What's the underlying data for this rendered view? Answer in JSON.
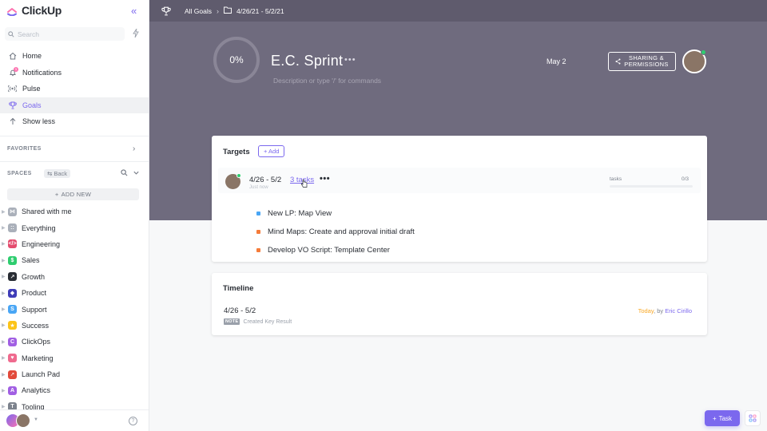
{
  "app": {
    "name": "ClickUp"
  },
  "sidebar": {
    "search_placeholder": "Search",
    "nav": [
      {
        "label": "Home",
        "icon": "home-icon"
      },
      {
        "label": "Notifications",
        "icon": "bell-icon",
        "badge": "1"
      },
      {
        "label": "Pulse",
        "icon": "pulse-icon"
      },
      {
        "label": "Goals",
        "icon": "trophy-icon",
        "active": true
      },
      {
        "label": "Show less",
        "icon": "arrow-up-icon"
      }
    ],
    "favorites_title": "FAVORITES",
    "spaces_title": "SPACES",
    "back_label": "Back",
    "add_new_label": "ADD NEW",
    "spaces": [
      {
        "label": "Shared with me",
        "color": "#aab0ba",
        "glyph": "⋈"
      },
      {
        "label": "Everything",
        "color": "#aab0ba",
        "glyph": "::"
      },
      {
        "label": "Engineering",
        "color": "#e44c6e",
        "glyph": "</>"
      },
      {
        "label": "Sales",
        "color": "#2ecd6f",
        "glyph": "$"
      },
      {
        "label": "Growth",
        "color": "#292d34",
        "glyph": "↗"
      },
      {
        "label": "Product",
        "color": "#3f3db8",
        "glyph": "◆"
      },
      {
        "label": "Support",
        "color": "#49a6f5",
        "glyph": "S"
      },
      {
        "label": "Success",
        "color": "#fcc419",
        "glyph": "★"
      },
      {
        "label": "ClickOps",
        "color": "#a15fe3",
        "glyph": "C"
      },
      {
        "label": "Marketing",
        "color": "#ef6a8e",
        "glyph": "♥"
      },
      {
        "label": "Launch Pad",
        "color": "#e24a3b",
        "glyph": "➚"
      },
      {
        "label": "Analytics",
        "color": "#a15fe3",
        "glyph": "A"
      },
      {
        "label": "Tooling",
        "color": "#7c828d",
        "glyph": "T"
      }
    ]
  },
  "topbar": {
    "all_goals": "All Goals",
    "folder": "4/26/21 - 5/2/21"
  },
  "goal": {
    "progress_text": "0%",
    "progress_fraction": 0,
    "title": "E.C. Sprint",
    "description_placeholder": "Description or type '/' for commands",
    "due_date": "May 2",
    "share_label_1": "SHARING &",
    "share_label_2": "PERMISSIONS"
  },
  "targets": {
    "title": "Targets",
    "add_label": "+ Add",
    "row": {
      "range": "4/26 - 5/2",
      "tasks_link": "3 tasks",
      "sub": "Just now",
      "progress_label": "tasks",
      "progress_count": "0/3",
      "progress_fraction": 0
    },
    "tasks": [
      {
        "label": "New LP: Map View",
        "color": "#49a6f5"
      },
      {
        "label": "Mind Maps: Create and approval initial draft",
        "color": "#f57c3a"
      },
      {
        "label": "Develop VO Script: Template Center",
        "color": "#f57c3a"
      }
    ]
  },
  "timeline": {
    "title": "Timeline",
    "range": "4/26 - 5/2",
    "note_badge": "NOTE",
    "note_text": "Created Key Result",
    "when": "Today",
    "by": ", by ",
    "author": "Eric Cirillo"
  },
  "fab": {
    "task_label": "Task"
  },
  "colors": {
    "accent": "#7b68ee",
    "hero": "#6f6b7e",
    "topbar": "#5f5b6d"
  }
}
